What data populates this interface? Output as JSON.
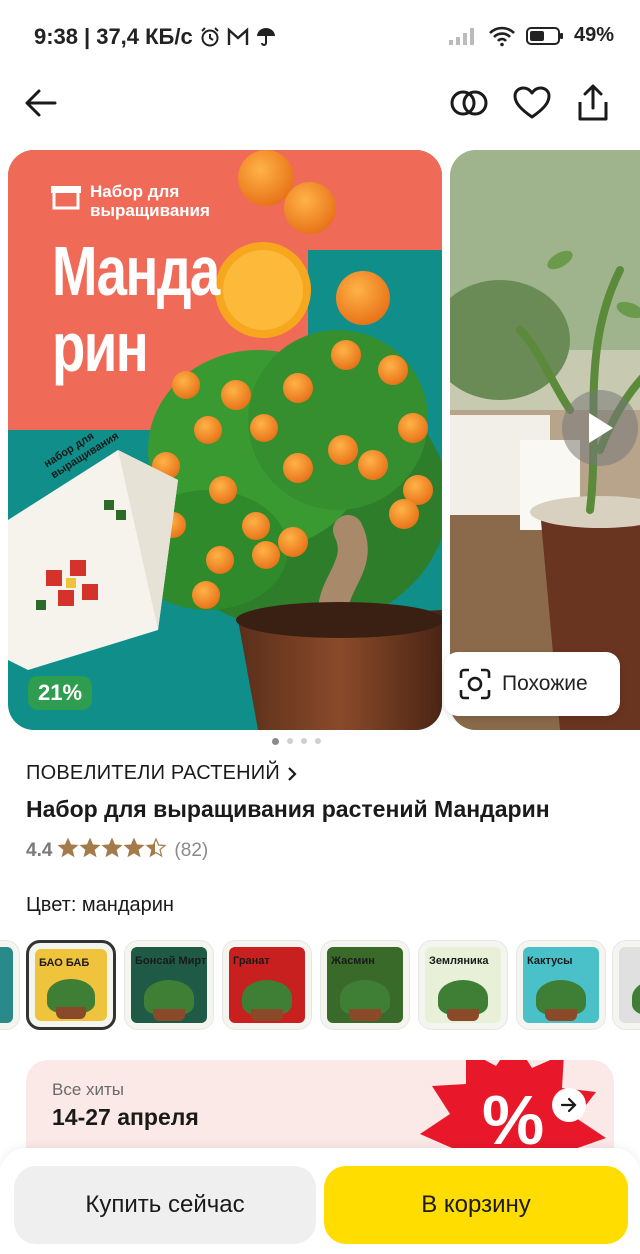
{
  "status_bar": {
    "time": "9:38",
    "speed": "37,4 КБ/с",
    "battery": "49%"
  },
  "header": {
    "back_icon": "arrow-left-icon",
    "compare_icon": "compare-circles-icon",
    "favorite_icon": "heart-icon",
    "share_icon": "share-icon"
  },
  "gallery": {
    "main_image": {
      "kit_label": "Набор для выращивания",
      "title_line1": "Манда",
      "title_line2": "рин",
      "box_text": "набор для выращивания"
    },
    "discount": "21%",
    "similar_label": "Похожие",
    "page_count": 4,
    "active_page": 1
  },
  "product": {
    "brand": "ПОВЕЛИТЕЛИ РАСТЕНИЙ",
    "title": "Набор для выращивания растений Мандарин",
    "rating": "4.4",
    "stars": 4.4,
    "reviews": "(82)",
    "color_label": "Цвет: мандарин"
  },
  "variants": [
    {
      "label": "",
      "bg": "#2a8a8a",
      "selected": false
    },
    {
      "label": "БАО БАБ",
      "bg": "#f0c33c",
      "selected": true
    },
    {
      "label": "Бонсай Мирт",
      "bg": "#1f5a46",
      "selected": false
    },
    {
      "label": "Гранат",
      "bg": "#c8201e",
      "selected": false
    },
    {
      "label": "Жасмин",
      "bg": "#3a6a2a",
      "selected": false
    },
    {
      "label": "Земляника",
      "bg": "#e8f0d8",
      "selected": false
    },
    {
      "label": "Кактусы",
      "bg": "#4ac0c8",
      "selected": false
    },
    {
      "label": "",
      "bg": "#e0e0e0",
      "selected": false
    }
  ],
  "promo": {
    "subtitle": "Все хиты",
    "dates": "14-27 апреля"
  },
  "actions": {
    "buy_now": "Купить сейчас",
    "add_to_cart": "В корзину"
  },
  "colors": {
    "accent_yellow": "#ffdd00",
    "discount_green": "#2e9d4f",
    "star_color": "#a57a4a",
    "promo_bg": "#fbe9e7"
  }
}
